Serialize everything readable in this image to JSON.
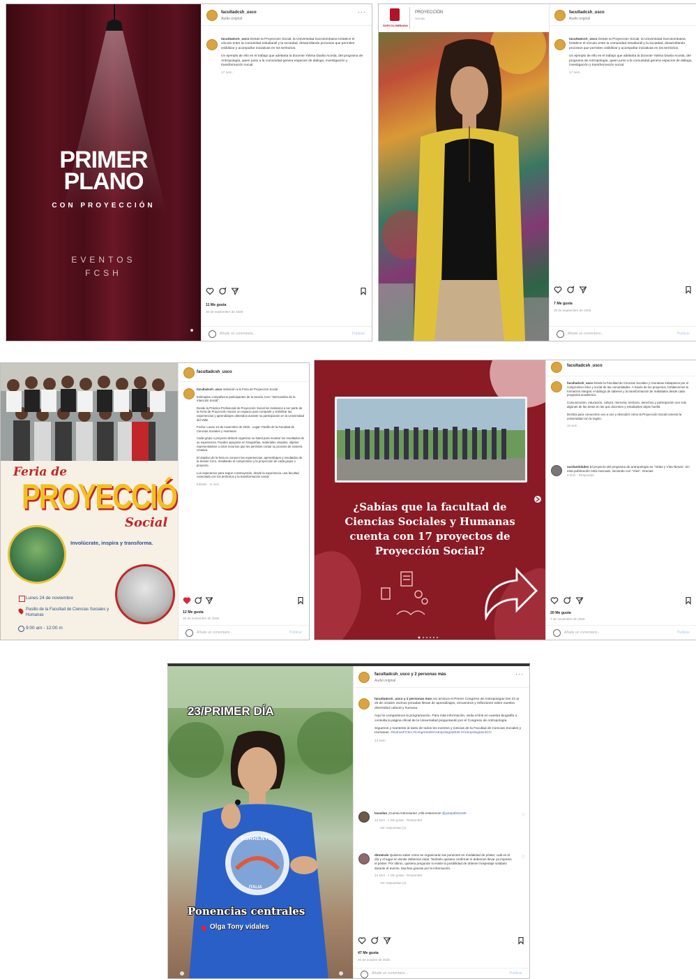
{
  "common": {
    "audio": "Audio original",
    "add_comment": "Añade un comentario...",
    "publish": "Publicar",
    "reply": "Responder",
    "likes_small": "1 Me gusta",
    "view_replies": "Ver respuestas"
  },
  "post1": {
    "username": "facultadcsh_usco",
    "media": {
      "title_line1": "PRIMER",
      "title_line2": "PLANO",
      "subtitle": "CON PROYECCIÓN",
      "events_line1": "EVENTOS",
      "events_line2": "FCSH"
    },
    "caption": {
      "p1": "Desde la Proyección Social, la Universidad Surcolombiana fortalece el vínculo entre la comunidad estudiantil y la sociedad, desarrollando procesos que permiten visibilizar y acompañar iniciativas en los territorios.",
      "p2": "Un ejemplo de ello es el trabajo que adelanta la docente Yolima Davila Acosta, del programa de Antropología, quien junto a la comunidad genera espacios de diálogo, investigación y transformación social.",
      "time": "17 sem"
    },
    "likes": "11 Me gusta",
    "date": "30 de septiembre de 2025"
  },
  "post2": {
    "username": "facultadcsh_usco",
    "media": {
      "logo_text": "SURCOLOMBIANA",
      "proj_title": "PROYECCIÓN",
      "proj_sub": "SOCIAL"
    },
    "caption": {
      "p1": "Desde la Proyección Social, la Universidad Surcolombiana fortalece el vínculo entre la comunidad estudiantil y la sociedad, desarrollando procesos que permiten visibilizar y acompañar iniciativas en los territorios.",
      "p2": "Un ejemplo de ello es el trabajo que adelanta la docente Yolima Davila Acosta, del programa de Antropología, quien junto a la comunidad genera espacios de diálogo, investigación y transformación social.",
      "time": "17 sem"
    },
    "likes": "7 Me gusta",
    "date": "30 de septiembre de 2025"
  },
  "post3": {
    "username": "facultadcsh_usco",
    "media": {
      "feria": "Feria de",
      "proyeccion": "PROYECCIÓN",
      "social": "Social",
      "tagline": "Involúcrate, inspira y transforma.",
      "date": "Lunes 24 de noviembre",
      "place": "Pasillo de la Facultad de Ciencias Sociales y Humanas",
      "hours": "9:00 am - 12:00 m"
    },
    "caption": {
      "p1": "Invitación a la Feria de Proyección Social",
      "p2": "Estimados compañeros participantes de la Sesión Cero \"Intercambio de la Intención Social\".",
      "p3": "Desde la Práctica Profesional de Proyección Social los invitamos a ser parte de la Feria de Proyección Social, un espacio para compartir y visibilizar las experiencias y aprendizajes obtenidos durante su participación en la Universidad del Valle.",
      "p4": "Fecha: Lunes 24 de noviembre de 2025 · Lugar: Pasillo de la Facultad de Ciencias Sociales y Humanas",
      "p5": "Cada grupo o proyecto deberá organizar su stand para mostrar los resultados de su experiencia. Pueden apoyarse en fotografías, materiales visuales, objetos representativos u otros recursos que les permitan contar su proceso de manera creativa.",
      "p6": "El objetivo de la feria es conocer las experiencias, aprendizajes y resultados de la Sesión Cero, resaltando el compromiso y la proyección de cada grupo o proyecto.",
      "p7": "Los esperamos para seguir construyendo, desde la experiencia, una facultad conectada con los territorios y la transformación social.",
      "time": "Editado · 11 sem"
    },
    "likes": "12 Me gusta",
    "date": "18 de noviembre de 2025"
  },
  "post4": {
    "username": "facultadcsh_usco",
    "media": {
      "q1": "¿Sabías que la facultad de",
      "q2": "Ciencias Sociales y Humanas",
      "q3": "cuenta con 17 proyectos de",
      "q4": "Proyección Social?"
    },
    "caption": {
      "p1": "Desde la Facultad de Ciencias Sociales y Humanas trabajamos por el compromiso ético y social de las comunidades. A través de los proyectos, fortalecemos la formación integral, el diálogo de saberes y la transformación de realidades desde cada programa académico.",
      "p2": "Comunicación, educación, cultura, memoria, territorio, derechos y participación son solo algunas de las áreas en las que docentes y estudiantes dejan huella.",
      "p3": "Desliza para conocerlos uno a uno y descubrir cómo la Proyección Social conecta la universidad con la región.",
      "time": "10 sem"
    },
    "comment": {
      "user": "surdantidades",
      "text": "El proyecto del programa de antropología es \"Vidas y Vías Nimas\". En esta publicación está marcado, iniciando con \"Vías\". Gracias",
      "meta": "9 sem · Responder"
    },
    "likes": "20 Me gusta",
    "date": "7 de noviembre de 2025"
  },
  "post5": {
    "username": "facultadcsh_usco y 2 personas más",
    "media": {
      "day": "23/PRIMER DÍA",
      "shirt": "SORRENTO",
      "shirt2": "ITALIA",
      "talk": "Ponencias centrales",
      "speaker": "Olga Tony vidales"
    },
    "caption": {
      "p1": "Así arranca el Primer Congreso de Antropología!",
      "p2": "Del 22 al 25 de octubre vivimos jornadas llenas de aprendizajes, encuentros y reflexiones sobre nuestra diversidad cultural y humana.",
      "p3": "Aquí te compartimos la programación. Para más información, visita el link en nuestra biografía o consulta la página oficial de la Universidad preguntando por el Congreso de Antropología.",
      "p4": "Síguenos y mantente al tanto de todos los eventos y noticias de la Facultad de Ciencias Sociales y Humanas.",
      "tags": "#SomosFCSH #CongresoDeAntropología2025 #AntropologíaUSCO",
      "time": "13 sem"
    },
    "comments": [
      {
        "user": "lavaslan",
        "text": "¡Cuenta interesante! ¡Allá estaremos!",
        "mention": "@juanpablo2100",
        "meta": "13 sem · 1 Me gusta · Responder",
        "replies": "Ver respuestas (1)"
      },
      {
        "user": "dmnerals",
        "text": "Quisiera saber cómo se organizarán las ponentes en modalidad de póster, cuál es el día y el lugar en donde debemos estar. También quisiera confirmar si debemos llevar ya impreso el póster. Por último, quisiera preguntar si existe la posibilidad de obtener hospedaje solidario durante el evento. Muchas gracias por la información.",
        "meta": "13 sem · 1 Me gusta · Responder",
        "replies": "Ver respuestas (2)"
      }
    ],
    "likes": "47 Me gusta",
    "date": "20 de octubre de 2025"
  }
}
